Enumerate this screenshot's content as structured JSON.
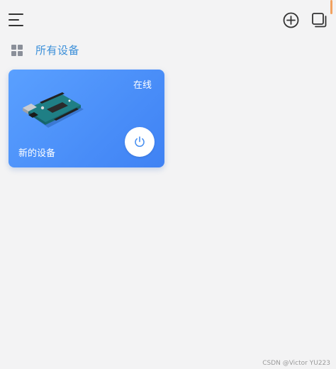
{
  "header": {
    "menu_icon": "menu-icon",
    "add_icon": "add-circle-icon",
    "layers_icon": "layers-icon"
  },
  "section": {
    "icon": "grid-icon",
    "title": "所有设备"
  },
  "devices": [
    {
      "name": "新的设备",
      "status": "在线",
      "image": "arduino-board-image",
      "power_icon": "power-icon"
    }
  ],
  "watermark": "CSDN @Victor YU223",
  "colors": {
    "accent": "#3b8fd9",
    "card_gradient_start": "#5aa0ff",
    "card_gradient_end": "#3f82f4",
    "background": "#f3f3f4"
  }
}
